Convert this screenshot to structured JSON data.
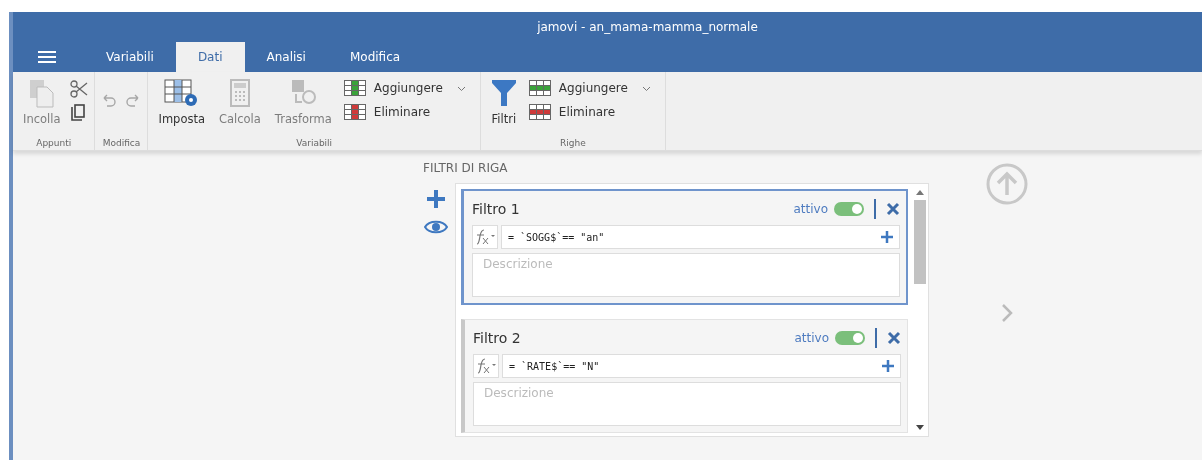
{
  "window": {
    "title": "jamovi - an_mama-mamma_normale"
  },
  "tabs": [
    {
      "label": "Variabili",
      "selected": false
    },
    {
      "label": "Dati",
      "selected": true
    },
    {
      "label": "Analisi",
      "selected": false
    },
    {
      "label": "Modifica",
      "selected": false
    }
  ],
  "ribbon": [
    {
      "label": "Appunti",
      "items": [
        {
          "kind": "paste",
          "label": "Incolla",
          "disabled": true
        },
        {
          "kind": "clip",
          "disabled": false
        }
      ]
    },
    {
      "label": "Modifica",
      "items": [
        {
          "kind": "undo",
          "disabled": true
        }
      ]
    },
    {
      "label": "Variabili",
      "items": [
        {
          "kind": "setup",
          "label": "Imposta",
          "disabled": false
        },
        {
          "kind": "compute",
          "label": "Calcola",
          "disabled": true
        },
        {
          "kind": "transform",
          "label": "Trasforma",
          "disabled": true
        },
        {
          "kind": "cols",
          "add": "Aggiungere",
          "remove": "Eliminare",
          "disabled": false
        }
      ]
    },
    {
      "label": "Righe",
      "items": [
        {
          "kind": "filter",
          "label": "Filtri",
          "disabled": false
        },
        {
          "kind": "rows",
          "add": "Aggiungere",
          "remove": "Eliminare",
          "disabled": false
        }
      ]
    }
  ],
  "filters": {
    "heading": "FILTRI DI RIGA",
    "items": [
      {
        "title": "Filtro 1",
        "status": "attivo",
        "on": true,
        "selected": true,
        "formula": "= `SOGG$`== \"an\"",
        "placeholder": "Descrizione"
      },
      {
        "title": "Filtro 2",
        "status": "attivo",
        "on": true,
        "selected": false,
        "formula": "= `RATE$`== \"N\"",
        "placeholder": "Descrizione"
      }
    ]
  }
}
